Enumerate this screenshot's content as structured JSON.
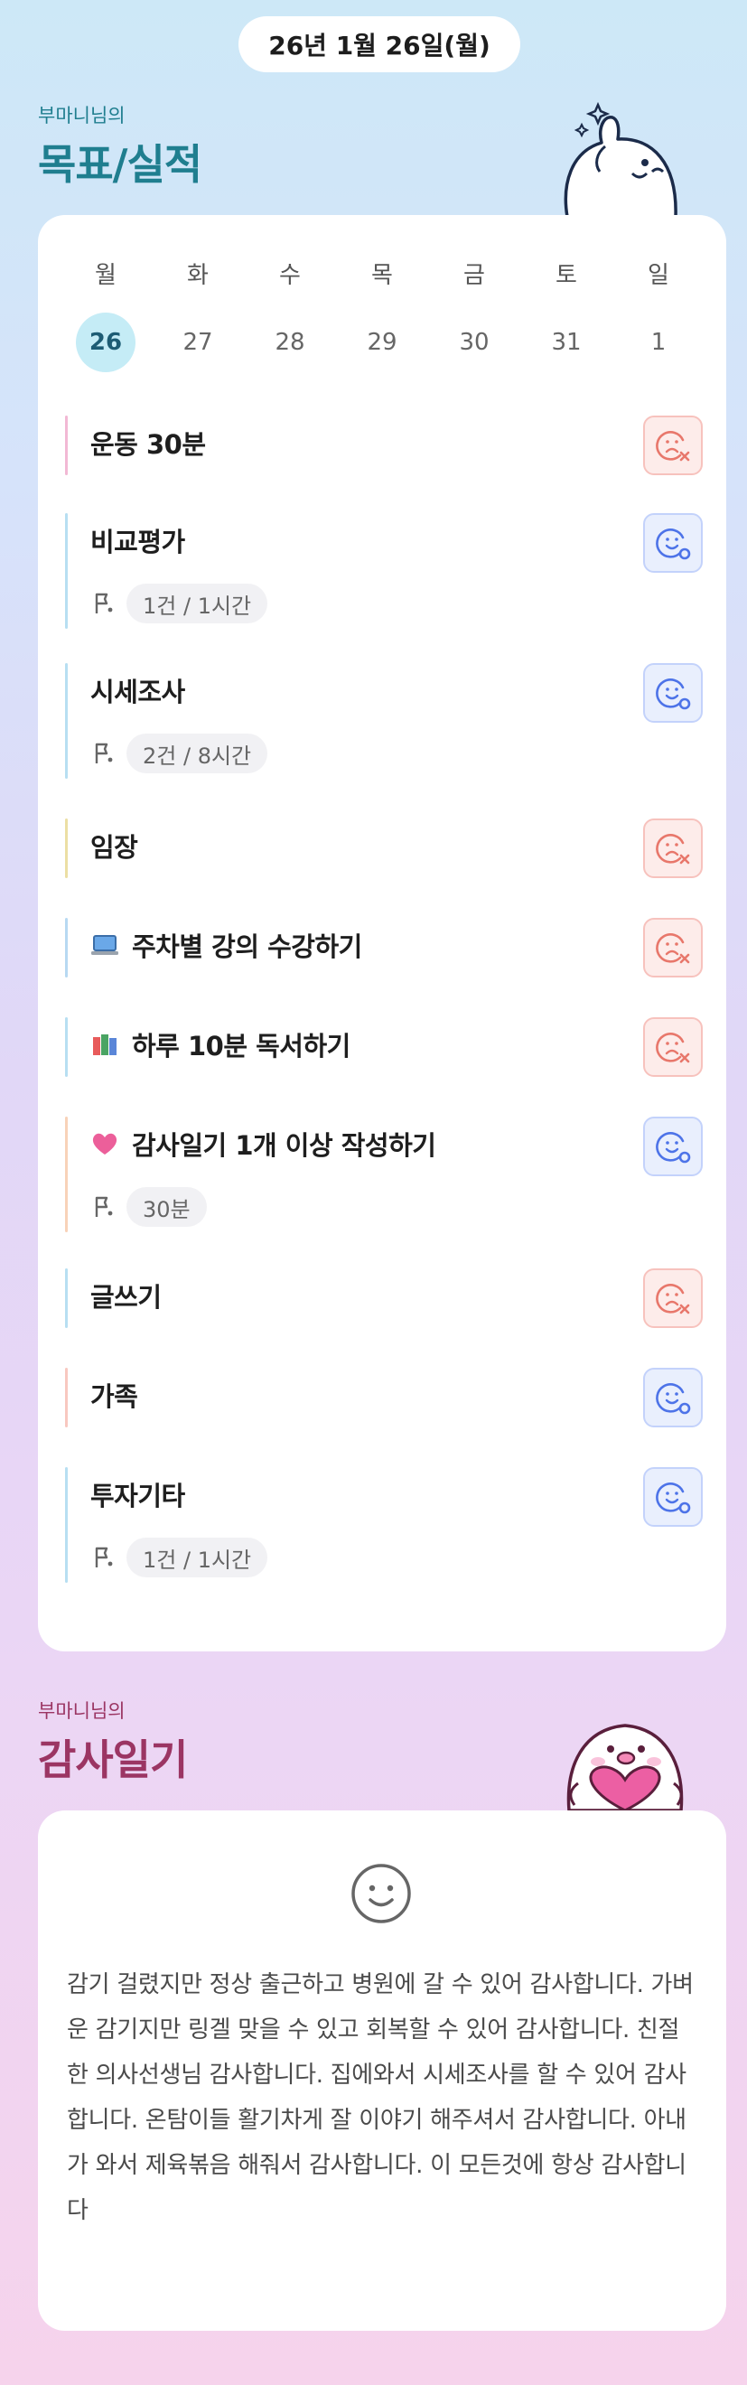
{
  "header": {
    "date": "26년 1월 26일(월)"
  },
  "goals_section": {
    "subtitle": "부마니님의",
    "title": "목표/실적"
  },
  "calendar": {
    "weekdays": [
      "월",
      "화",
      "수",
      "목",
      "금",
      "토",
      "일"
    ],
    "dates": [
      "26",
      "27",
      "28",
      "29",
      "30",
      "31",
      "1"
    ],
    "selected_index": 0
  },
  "goals": [
    {
      "title": "운동 30분",
      "meta": "",
      "status": "fail",
      "bar_color": "#f2b8d4"
    },
    {
      "title": "비교평가",
      "meta": "1건 / 1시간",
      "status": "done",
      "bar_color": "#b7dff2"
    },
    {
      "title": "시세조사",
      "meta": "2건 / 8시간",
      "status": "done",
      "bar_color": "#b7dff2"
    },
    {
      "title": "임장",
      "meta": "",
      "status": "fail",
      "bar_color": "#ecdfa4"
    },
    {
      "title": "주차별 강의 수강하기",
      "meta": "",
      "status": "fail",
      "bar_color": "#b7d9f2",
      "emoji": "laptop"
    },
    {
      "title": "하루 10분 독서하기",
      "meta": "",
      "status": "fail",
      "bar_color": "#b7dff2",
      "emoji": "books"
    },
    {
      "title": "감사일기 1개 이상 작성하기",
      "meta": "30분",
      "status": "done",
      "bar_color": "#f8d2b8",
      "emoji": "heart"
    },
    {
      "title": "글쓰기",
      "meta": "",
      "status": "fail",
      "bar_color": "#b7dff2"
    },
    {
      "title": "가족",
      "meta": "",
      "status": "done",
      "bar_color": "#f8c8c0"
    },
    {
      "title": "투자기타",
      "meta": "1건 / 1시간",
      "status": "done",
      "bar_color": "#b7dff2"
    }
  ],
  "diary_section": {
    "subtitle": "부마니님의",
    "title": "감사일기",
    "text": "감기 걸렸지만 정상 출근하고 병원에 갈 수 있어 감사합니다. 가벼운 감기지만 링겔 맞을 수 있고 회복할 수 있어 감사합니다. 친절한 의사선생님 감사합니다. 집에와서 시세조사를 할 수 있어 감사합니다. 온탐이들 활기차게 잘 이야기 해주셔서 감사합니다. 아내가 와서 제육볶음 해줘서 감사합니다. 이 모든것에 항상 감사합니다"
  },
  "icons": {
    "fail": "sad-face-x-icon",
    "done": "smile-face-check-icon",
    "meta": "flag-icon",
    "diary": "smile-icon"
  },
  "colors": {
    "fail_bg": "#fdecea",
    "fail_stroke": "#e8776b",
    "done_bg": "#e9effd",
    "done_stroke": "#4d73e8",
    "goals_title": "#1f7e8f",
    "diary_title": "#9b3563"
  }
}
